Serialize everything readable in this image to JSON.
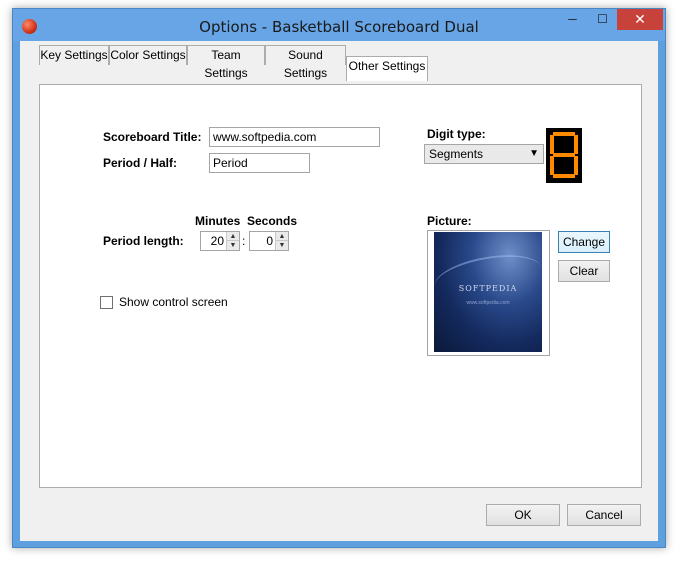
{
  "window": {
    "title": "Options - Basketball Scoreboard Dual",
    "minimize": "─",
    "maximize": "☐",
    "close": "✕"
  },
  "tabs": [
    {
      "label": "Key Settings"
    },
    {
      "label": "Color Settings"
    },
    {
      "label": "Team Settings"
    },
    {
      "label": "Sound Settings"
    },
    {
      "label": "Other Settings",
      "active": true
    }
  ],
  "form": {
    "scoreboard_title_label": "Scoreboard Title:",
    "scoreboard_title_value": "www.softpedia.com",
    "period_label": "Period / Half:",
    "period_value": "Period",
    "digit_type_label": "Digit type:",
    "digit_type_value": "Segments",
    "digit_preview": "8",
    "digit_color": "#ff8a00",
    "minutes_header": "Minutes",
    "seconds_header": "Seconds",
    "period_length_label": "Period length:",
    "minutes_value": "20",
    "seconds_value": "0",
    "colon": ":",
    "show_control_label": "Show control screen",
    "show_control_checked": false,
    "picture_label": "Picture:",
    "picture_text": "SOFTPEDIA",
    "picture_sub": "www.softpedia.com",
    "change_button": "Change",
    "clear_button": "Clear"
  },
  "footer": {
    "ok_button": "OK",
    "cancel_button": "Cancel"
  }
}
